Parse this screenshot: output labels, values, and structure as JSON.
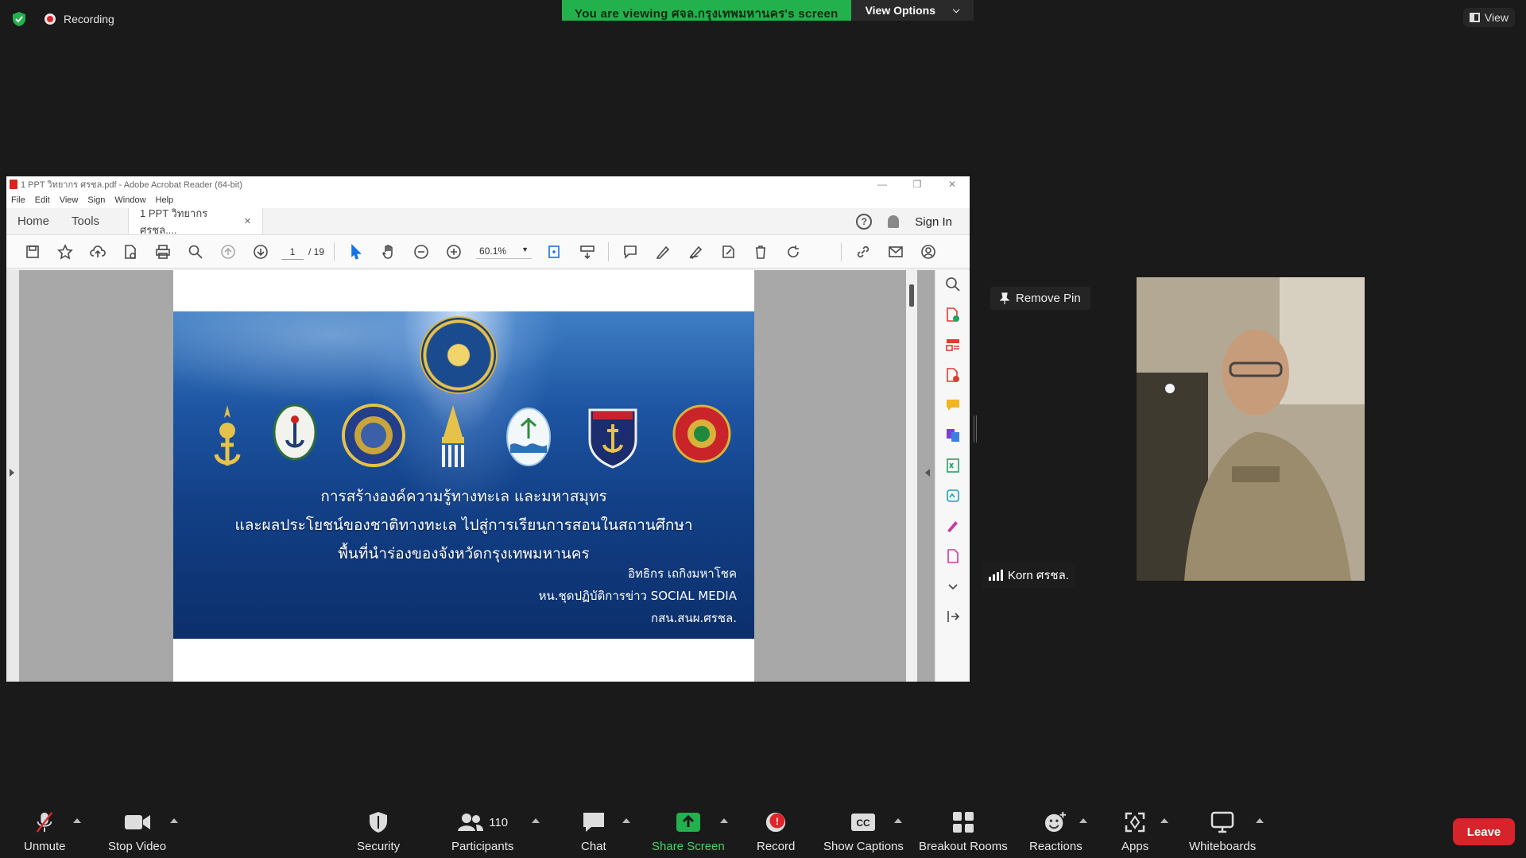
{
  "top_bar": {
    "recording_label": "Recording",
    "viewing_banner": "You are viewing ศจล.กรุงเทพมหานคร's screen",
    "view_options_label": "View Options",
    "view_label": "View"
  },
  "acrobat": {
    "window_title": "1 PPT วิทยากร ศรชล.pdf - Adobe Acrobat Reader (64-bit)",
    "menu": [
      "File",
      "Edit",
      "View",
      "Sign",
      "Window",
      "Help"
    ],
    "tabs": {
      "home": "Home",
      "tools": "Tools",
      "doc": "1 PPT วิทยากร ศรชล...."
    },
    "sign_in": "Sign In",
    "page_current": "1",
    "page_total": "/ 19",
    "zoom": "60.1%"
  },
  "slide": {
    "title_line1": "การสร้างองค์ความรู้ทางทะเล และมหาสมุทร",
    "title_line2": "และผลประโยชน์ของชาติทางทะเล ไปสู่การเรียนการสอนในสถานศึกษา",
    "title_line3": "พื้นที่นำร่องของจังหวัดกรุงเทพมหานคร",
    "author_line1": "อิทธิกร เถกิงมหาโชค",
    "author_line2": "หน.ชุดปฏิบัติการข่าว SOCIAL MEDIA",
    "author_line3": "กสน.สนผ.ศรชล."
  },
  "participant": {
    "remove_pin_label": "Remove Pin",
    "name": "Korn ศรชล."
  },
  "toolbar": {
    "unmute": "Unmute",
    "stop_video": "Stop Video",
    "security": "Security",
    "participants": "Participants",
    "participants_count": "110",
    "chat": "Chat",
    "share_screen": "Share Screen",
    "record": "Record",
    "show_captions": "Show Captions",
    "breakout_rooms": "Breakout Rooms",
    "reactions": "Reactions",
    "apps": "Apps",
    "whiteboards": "Whiteboards",
    "leave": "Leave"
  },
  "colors": {
    "share_banner": "#23b14d",
    "leave": "#d6242a",
    "share_screen_text": "#4bd36b"
  }
}
